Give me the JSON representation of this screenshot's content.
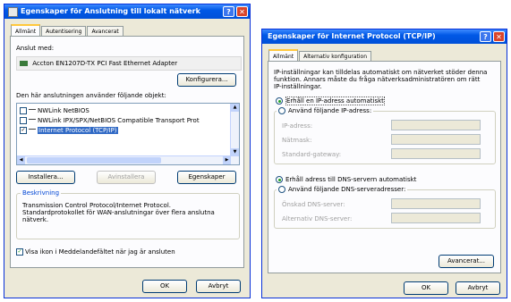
{
  "left": {
    "title": "Egenskaper för Anslutning till lokalt nätverk",
    "tabs": [
      "Allmänt",
      "Autentisering",
      "Avancerat"
    ],
    "connect_using_label": "Anslut med:",
    "adapter": "Accton EN1207D-TX PCI Fast Ethernet Adapter",
    "configure_button": "Konfigurera...",
    "items_label": "Den här anslutningen använder följande objekt:",
    "items": [
      {
        "label": "NWLink NetBIOS",
        "checked": false
      },
      {
        "label": "NWLink IPX/SPX/NetBIOS Compatible Transport Prot",
        "checked": false
      },
      {
        "label": "Internet Protocol (TCP/IP)",
        "checked": true,
        "selected": true
      }
    ],
    "install_button": "Installera...",
    "uninstall_button": "Avinstallera",
    "properties_button": "Egenskaper",
    "description_label": "Beskrivning",
    "description_text": "Transmission Control Protocol/Internet Protocol. Standardprotokollet för WAN-anslutningar över flera anslutna nätverk.",
    "show_icon_label": "Visa ikon i Meddelandefältet när jag är ansluten",
    "show_icon_checked": true,
    "ok_button": "OK",
    "cancel_button": "Avbryt"
  },
  "right": {
    "title": "Egenskaper för Internet Protocol (TCP/IP)",
    "tabs": [
      "Allmänt",
      "Alternativ konfiguration"
    ],
    "intro": "IP-inställningar kan tilldelas automatiskt om nätverket stöder denna funktion. Annars måste du fråga nätverksadministratören om rätt IP-inställningar.",
    "auto_ip": "Erhåll en IP-adress automatiskt",
    "manual_ip": "Använd följande IP-adress:",
    "ip_label": "IP-adress:",
    "mask_label": "Nätmask:",
    "gateway_label": "Standard-gateway:",
    "auto_dns": "Erhåll adress till DNS-servern automatiskt",
    "manual_dns": "Använd följande DNS-serveradresser:",
    "preferred_dns_label": "Önskad DNS-server:",
    "alternate_dns_label": "Alternativ DNS-server:",
    "advanced_button": "Avancerat...",
    "ok_button": "OK",
    "cancel_button": "Avbryt"
  }
}
